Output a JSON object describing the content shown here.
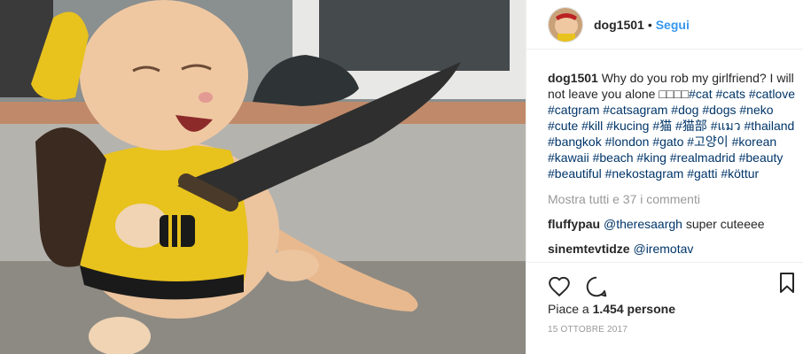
{
  "post": {
    "username": "dog1501",
    "dot": "•",
    "follow": "Segui",
    "caption_text": "Why do you rob my girlfriend? I will not leave you alone □□□□",
    "hashtags": [
      "#cat",
      "#cats",
      "#catlove",
      "#catgram",
      "#catsagram",
      "#dog",
      "#dogs",
      "#neko",
      "#cute",
      "#kill",
      "#kucing",
      "#猫",
      "#猫部",
      "#แมว",
      "#thailand",
      "#bangkok",
      "#london",
      "#gato",
      "#고양이",
      "#korean",
      "#kawaii",
      "#beach",
      "#king",
      "#realmadrid",
      "#beauty",
      "#beautiful",
      "#nekostagram",
      "#gatti",
      "#köttur"
    ],
    "view_all": "Mostra tutti e 37 i commenti",
    "comments": [
      {
        "user": "fluffypau",
        "mention": "@theresaargh",
        "text": " super cuteeee"
      },
      {
        "user": "sinemtevtidze",
        "mention": "@iremotav",
        "text": ""
      }
    ],
    "likes_prefix": "Piace a ",
    "likes_count": "1.454 persone",
    "date": "15 OTTOBRE 2017"
  },
  "icons": {
    "like": "heart-icon",
    "comment": "comment-icon",
    "save": "bookmark-icon",
    "photo": "cat-with-knife-photo"
  },
  "colors": {
    "link": "#3897f0",
    "hashtag": "#003569",
    "muted": "#999999",
    "text": "#262626"
  }
}
